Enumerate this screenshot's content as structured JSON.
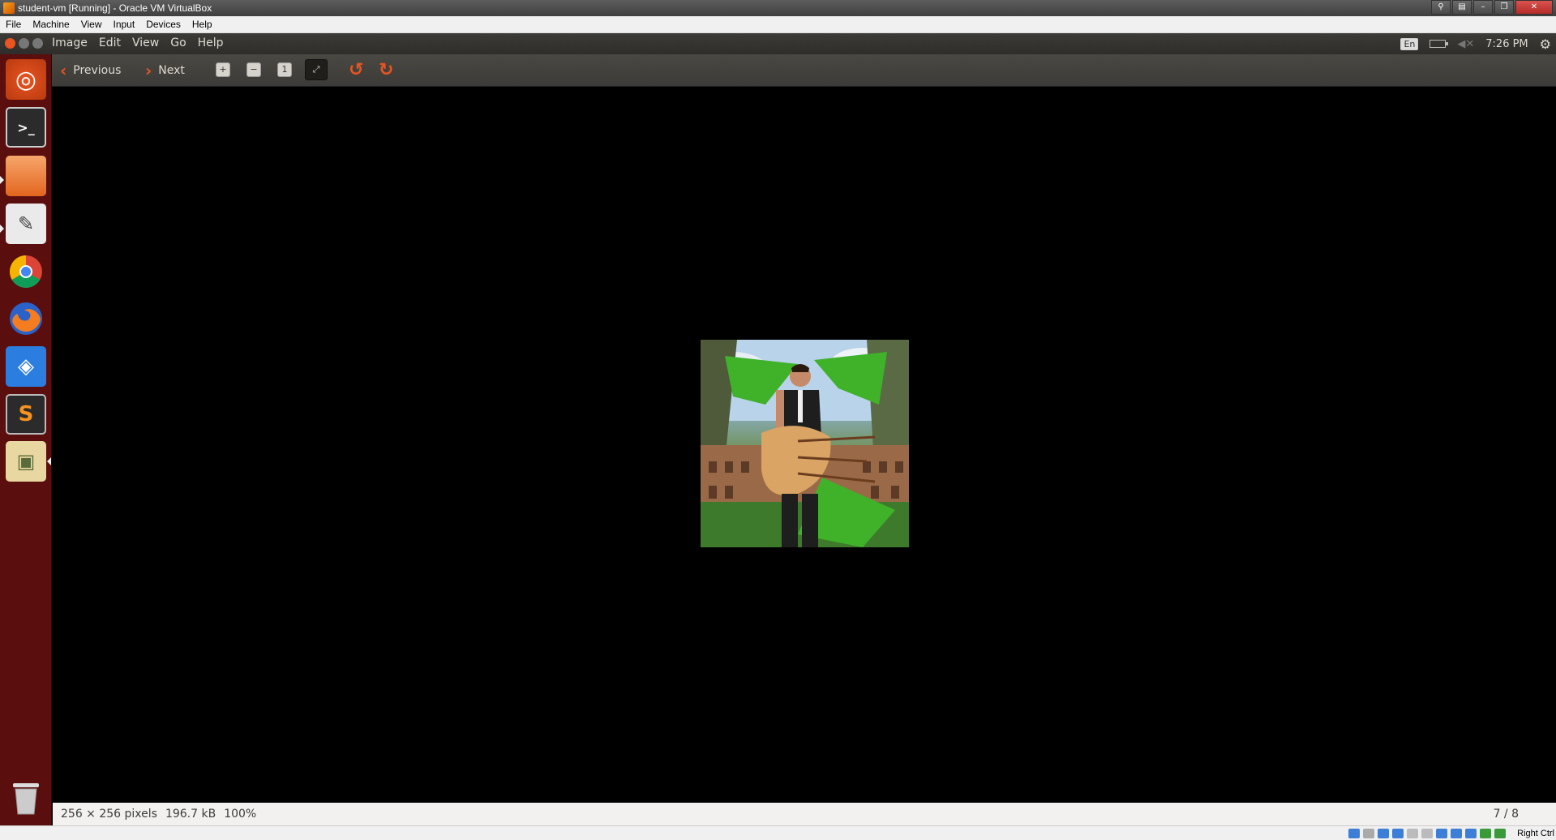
{
  "host_window": {
    "title": "student-vm [Running] - Oracle VM VirtualBox",
    "controls": [
      "pin-icon",
      "tb-icon",
      "minimize-icon",
      "restore-icon",
      "close-icon"
    ]
  },
  "vbox_menu": [
    "File",
    "Machine",
    "View",
    "Input",
    "Devices",
    "Help"
  ],
  "app_menu": [
    "Image",
    "Edit",
    "View",
    "Go",
    "Help"
  ],
  "indicators": {
    "keyboard": "En",
    "time": "7:26 PM"
  },
  "toolbar": {
    "previous_label": "Previous",
    "next_label": "Next"
  },
  "launcher": [
    {
      "name": "dash-home",
      "icon": "ubuntu-logo-icon"
    },
    {
      "name": "terminal",
      "icon": "terminal-icon"
    },
    {
      "name": "files",
      "icon": "folder-icon"
    },
    {
      "name": "text-editor",
      "icon": "text-editor-icon"
    },
    {
      "name": "chrome",
      "icon": "chrome-icon"
    },
    {
      "name": "firefox",
      "icon": "firefox-icon"
    },
    {
      "name": "dropbox",
      "icon": "dropbox-icon"
    },
    {
      "name": "sublime-text",
      "icon": "sublime-icon"
    },
    {
      "name": "image-viewer",
      "icon": "image-viewer-icon"
    },
    {
      "name": "trash",
      "icon": "trash-icon"
    }
  ],
  "status": {
    "dimensions": "256 × 256 pixels",
    "size": "196.7 kB",
    "zoom": "100%",
    "position": "7 / 8"
  },
  "vbox_status": {
    "host_key": "Right Ctrl"
  },
  "colors": {
    "accent": "#e95420",
    "launcher_bg": "#5a0e0e",
    "panel_bg": "#3c3b37"
  }
}
